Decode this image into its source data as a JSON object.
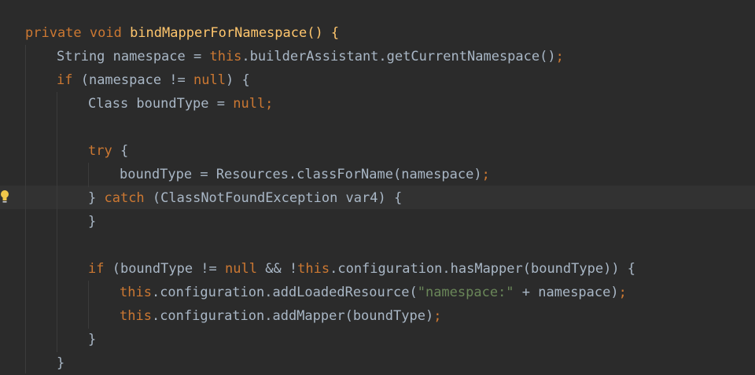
{
  "editor": {
    "lines": [
      {
        "indent": 0,
        "tokens": [
          {
            "t": "private void ",
            "c": "kw"
          },
          {
            "t": "bindMapperForNamespace() {",
            "c": "fn"
          }
        ]
      },
      {
        "indent": 1,
        "tokens": [
          {
            "t": "String namespace = "
          },
          {
            "t": "this",
            "c": "kw"
          },
          {
            "t": ".builderAssistant.getCurrentNamespace()"
          },
          {
            "t": ";",
            "c": "kw"
          }
        ]
      },
      {
        "indent": 1,
        "tokens": [
          {
            "t": "if ",
            "c": "kw"
          },
          {
            "t": "(namespace != "
          },
          {
            "t": "null",
            "c": "kw"
          },
          {
            "t": ") {"
          }
        ]
      },
      {
        "indent": 2,
        "tokens": [
          {
            "t": "Class boundType = "
          },
          {
            "t": "null;",
            "c": "kw"
          }
        ]
      },
      {
        "indent": 0,
        "tokens": []
      },
      {
        "indent": 2,
        "tokens": [
          {
            "t": "try ",
            "c": "kw"
          },
          {
            "t": "{"
          }
        ]
      },
      {
        "indent": 3,
        "tokens": [
          {
            "t": "boundType = Resources.classForName(namespace)"
          },
          {
            "t": ";",
            "c": "kw"
          }
        ]
      },
      {
        "indent": 2,
        "tokens": [
          {
            "t": "} "
          },
          {
            "t": "catch ",
            "c": "kw"
          },
          {
            "t": "(ClassNotFoundException var4) {"
          }
        ]
      },
      {
        "indent": 2,
        "tokens": [
          {
            "t": "}"
          }
        ]
      },
      {
        "indent": 0,
        "tokens": []
      },
      {
        "indent": 2,
        "tokens": [
          {
            "t": "if ",
            "c": "kw"
          },
          {
            "t": "(boundType != "
          },
          {
            "t": "null ",
            "c": "kw"
          },
          {
            "t": "&& !"
          },
          {
            "t": "this",
            "c": "kw"
          },
          {
            "t": ".configuration.hasMapper(boundType)) {"
          }
        ]
      },
      {
        "indent": 3,
        "tokens": [
          {
            "t": "this",
            "c": "kw"
          },
          {
            "t": ".configuration.addLoadedResource("
          },
          {
            "t": "\"namespace:\"",
            "c": "str"
          },
          {
            "t": " + namespace)"
          },
          {
            "t": ";",
            "c": "kw"
          }
        ]
      },
      {
        "indent": 3,
        "tokens": [
          {
            "t": "this",
            "c": "kw"
          },
          {
            "t": ".configuration.addMapper(boundType)"
          },
          {
            "t": ";",
            "c": "kw"
          }
        ]
      },
      {
        "indent": 2,
        "tokens": [
          {
            "t": "}"
          }
        ]
      },
      {
        "indent": 1,
        "tokens": [
          {
            "t": "}"
          }
        ]
      }
    ],
    "highlighted_line": 8,
    "gutter_icon": "lightbulb-icon",
    "colors": {
      "background": "#2b2b2b",
      "caret_line": "#323232",
      "default_text": "#a9b7c6",
      "keyword": "#cc7832",
      "method_declaration": "#ffc66d",
      "string": "#6a8759",
      "indent_guide": "#3b3b3b",
      "lightbulb": "#f0c64a"
    }
  }
}
